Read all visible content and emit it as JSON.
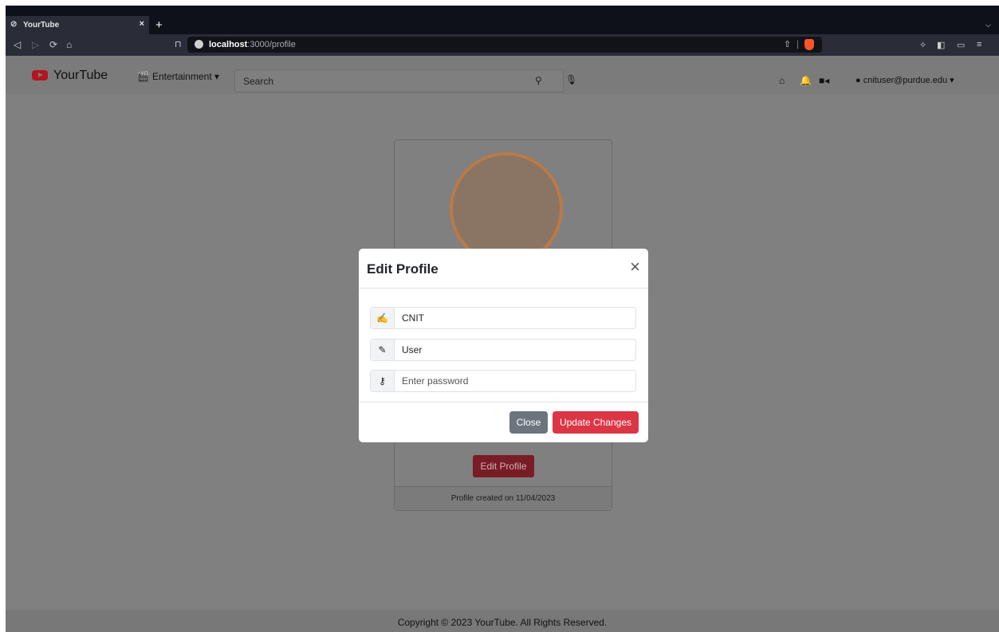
{
  "browser": {
    "tab_title": "YourTube",
    "tab_close": "×",
    "new_tab": "+",
    "url_host": "localhost",
    "url_path": ":3000/profile"
  },
  "app": {
    "brand": "YourTube",
    "category": "Entertainment",
    "search_placeholder": "Search",
    "user_email": "cnituser@purdue.edu"
  },
  "profile": {
    "edit_button": "Edit Profile",
    "created": "Profile created on 11/04/2023"
  },
  "modal": {
    "title": "Edit Profile",
    "close_icon": "×",
    "first_name": "CNIT",
    "last_name": "User",
    "password_placeholder": "Enter password",
    "close_button": "Close",
    "update_button": "Update Changes"
  },
  "footer": {
    "text": "Copyright © 2023 YourTube. All Rights Reserved."
  },
  "icons": {
    "tab": "globe-icon",
    "back": "back-icon",
    "forward": "forward-icon",
    "reload": "reload-icon",
    "home": "home-icon",
    "bookmark": "bookmark-icon",
    "lock": "lock-icon",
    "share": "share-icon",
    "brave": "brave-shield-icon",
    "extensions": "extensions-icon",
    "sidebar": "sidebar-icon",
    "wallet": "wallet-icon",
    "menu": "menu-icon",
    "clapper": "clapperboard-icon",
    "search": "search-icon",
    "mic": "microphone-icon",
    "nav_home": "home-icon",
    "bell": "bell-icon",
    "video": "video-camera-icon",
    "user": "user-icon",
    "signature": "signature-icon",
    "edit": "edit-icon",
    "key": "key-icon"
  },
  "colors": {
    "accent": "#dc3545",
    "secondary": "#6c757d",
    "brand_red": "#b4151f",
    "avatar_ring": "#ba7a47"
  }
}
